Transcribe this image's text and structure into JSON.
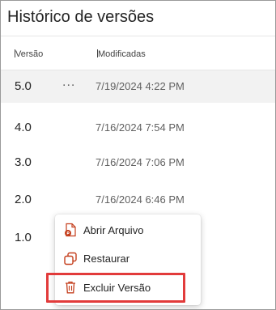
{
  "panel": {
    "title": "Histórico de versões",
    "columns": {
      "version": "Versão",
      "modified": "Modificadas"
    }
  },
  "rows": [
    {
      "version": "5.0",
      "modified": "7/19/2024 4:22 PM",
      "more": "...",
      "selected": true
    },
    {
      "version": "4.0",
      "modified": "7/16/2024 7:54 PM"
    },
    {
      "version": "3.0",
      "modified": "7/16/2024 7:06 PM"
    },
    {
      "version": "2.0",
      "modified": "7/16/2024 6:46 PM"
    },
    {
      "version": "1.0"
    }
  ],
  "context_menu": {
    "items": [
      {
        "label": "Abrir Arquivo",
        "icon": "word-file-icon"
      },
      {
        "label": "Restaurar",
        "icon": "restore-icon"
      },
      {
        "label": "Excluir Versão",
        "icon": "trash-icon"
      }
    ]
  },
  "colors": {
    "highlight": "#e23b3b",
    "selected_row": "#f2f2f2",
    "icon_orange": "#c43e1c"
  }
}
